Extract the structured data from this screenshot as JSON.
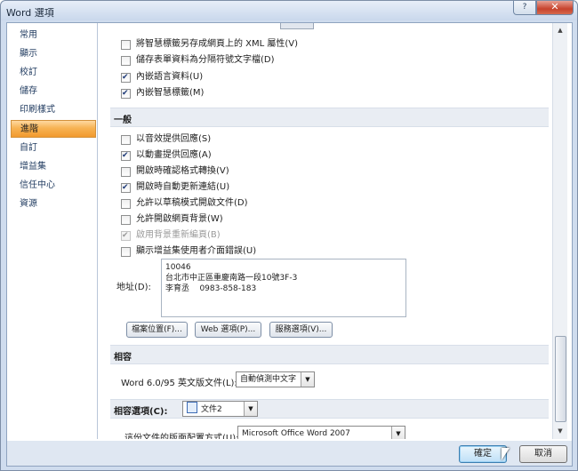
{
  "window": {
    "title": "Word 選項",
    "help": "?",
    "close": "✕"
  },
  "nav": {
    "items": [
      "常用",
      "顯示",
      "校訂",
      "儲存",
      "印刷樣式",
      "進階",
      "自訂",
      "增益集",
      "信任中心",
      "資源"
    ],
    "active_index": 5
  },
  "top_options": [
    {
      "label": "將智慧標籤另存成網頁上的 XML 屬性(V)",
      "checked": false
    },
    {
      "label": "儲存表單資料為分隔符號文字檔(D)",
      "checked": false
    },
    {
      "label": "內嵌語言資料(U)",
      "checked": true
    },
    {
      "label": "內嵌智慧標籤(M)",
      "checked": true
    }
  ],
  "general": {
    "header": "一般",
    "options": [
      {
        "label": "以音效提供回應(S)",
        "checked": false,
        "disabled": false
      },
      {
        "label": "以動畫提供回應(A)",
        "checked": true,
        "disabled": false
      },
      {
        "label": "開啟時確認格式轉換(V)",
        "checked": false,
        "disabled": false
      },
      {
        "label": "開啟時自動更新連結(U)",
        "checked": true,
        "disabled": false
      },
      {
        "label": "允許以草稿模式開啟文件(D)",
        "checked": false,
        "disabled": false
      },
      {
        "label": "允許開啟網頁背景(W)",
        "checked": false,
        "disabled": false
      },
      {
        "label": "啟用背景重新編頁(B)",
        "checked": true,
        "disabled": true
      },
      {
        "label": "顯示增益集使用者介面錯誤(U)",
        "checked": false,
        "disabled": false
      }
    ],
    "address_label": "地址(D):",
    "address_value": "10046\n台北市中正區重慶南路一段10號3F-3\n李育丞    0983-858-183",
    "buttons": [
      "檔案位置(F)...",
      "Web 選項(P)...",
      "服務選項(V)..."
    ]
  },
  "compat": {
    "header": "相容",
    "word_label": "Word 6.0/95 英文版文件(L):",
    "word_value": "自動偵測中文字"
  },
  "compat_options": {
    "label": "相容選項(C):",
    "doc_value": "文件2",
    "layout_label": "這份文件的版面配置方式(U):",
    "layout_value": "Microsoft Office Word 2007"
  },
  "footer": {
    "ok": "確定",
    "cancel": "取消"
  }
}
